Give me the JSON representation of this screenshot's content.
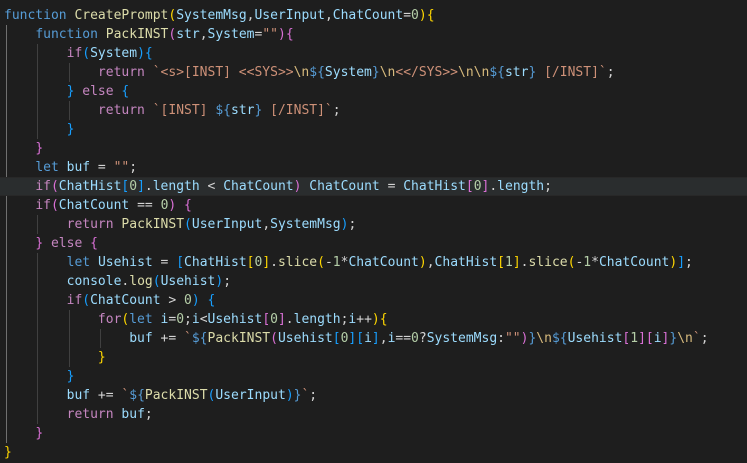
{
  "editor": {
    "language": "javascript",
    "theme": "dark",
    "lines": [
      [
        [
          "kw",
          "function"
        ],
        [
          "op",
          " "
        ],
        [
          "fn",
          "CreatePrompt"
        ],
        [
          "b1",
          "("
        ],
        [
          "var",
          "SystemMsg"
        ],
        [
          "op",
          ","
        ],
        [
          "var",
          "UserInput"
        ],
        [
          "op",
          ","
        ],
        [
          "var",
          "ChatCount"
        ],
        [
          "op",
          "="
        ],
        [
          "num",
          "0"
        ],
        [
          "b1",
          ")"
        ],
        [
          "b1",
          "{"
        ]
      ],
      [
        [
          "op",
          "    "
        ],
        [
          "kw",
          "function"
        ],
        [
          "op",
          " "
        ],
        [
          "fn",
          "PackINST"
        ],
        [
          "b2",
          "("
        ],
        [
          "var",
          "str"
        ],
        [
          "op",
          ","
        ],
        [
          "var",
          "System"
        ],
        [
          "op",
          "="
        ],
        [
          "str",
          "\"\""
        ],
        [
          "b2",
          ")"
        ],
        [
          "b2",
          "{"
        ]
      ],
      [
        [
          "op",
          "        "
        ],
        [
          "ctl",
          "if"
        ],
        [
          "b3",
          "("
        ],
        [
          "var",
          "System"
        ],
        [
          "b3",
          ")"
        ],
        [
          "b3",
          "{"
        ]
      ],
      [
        [
          "op",
          "            "
        ],
        [
          "ctl",
          "return"
        ],
        [
          "op",
          " "
        ],
        [
          "str",
          "`<s>[INST] <<SYS>>"
        ],
        [
          "esc",
          "\\n"
        ],
        [
          "kw",
          "${"
        ],
        [
          "var",
          "System"
        ],
        [
          "kw",
          "}"
        ],
        [
          "esc",
          "\\n"
        ],
        [
          "str",
          "<</SYS>>"
        ],
        [
          "esc",
          "\\n\\n"
        ],
        [
          "kw",
          "${"
        ],
        [
          "var",
          "str"
        ],
        [
          "kw",
          "}"
        ],
        [
          "str",
          " [/INST]`"
        ],
        [
          "op",
          ";"
        ]
      ],
      [
        [
          "op",
          "        "
        ],
        [
          "b3",
          "}"
        ],
        [
          "op",
          " "
        ],
        [
          "ctl",
          "else"
        ],
        [
          "op",
          " "
        ],
        [
          "b3",
          "{"
        ]
      ],
      [
        [
          "op",
          "            "
        ],
        [
          "ctl",
          "return"
        ],
        [
          "op",
          " "
        ],
        [
          "str",
          "`[INST] "
        ],
        [
          "kw",
          "${"
        ],
        [
          "var",
          "str"
        ],
        [
          "kw",
          "}"
        ],
        [
          "str",
          " [/INST]`"
        ],
        [
          "op",
          ";"
        ]
      ],
      [
        [
          "op",
          "        "
        ],
        [
          "b3",
          "}"
        ]
      ],
      [
        [
          "op",
          "    "
        ],
        [
          "b2",
          "}"
        ]
      ],
      [
        [
          "op",
          "    "
        ],
        [
          "kw",
          "let"
        ],
        [
          "op",
          " "
        ],
        [
          "var",
          "buf"
        ],
        [
          "op",
          " = "
        ],
        [
          "str",
          "\"\""
        ],
        [
          "op",
          ";"
        ]
      ],
      [
        [
          "op",
          "    "
        ],
        [
          "ctl",
          "if"
        ],
        [
          "b2",
          "("
        ],
        [
          "var",
          "ChatHist"
        ],
        [
          "b3",
          "["
        ],
        [
          "num",
          "0"
        ],
        [
          "b3",
          "]"
        ],
        [
          "op",
          "."
        ],
        [
          "var",
          "length"
        ],
        [
          "op",
          " < "
        ],
        [
          "var",
          "ChatCount"
        ],
        [
          "b2",
          ")"
        ],
        [
          "op",
          " "
        ],
        [
          "var",
          "ChatCount"
        ],
        [
          "op",
          " = "
        ],
        [
          "var",
          "ChatHist"
        ],
        [
          "b2",
          "["
        ],
        [
          "num",
          "0"
        ],
        [
          "b2",
          "]"
        ],
        [
          "op",
          "."
        ],
        [
          "var",
          "length"
        ],
        [
          "op",
          ";"
        ]
      ],
      [
        [
          "op",
          "    "
        ],
        [
          "ctl",
          "if"
        ],
        [
          "b2",
          "("
        ],
        [
          "var",
          "ChatCount"
        ],
        [
          "op",
          " == "
        ],
        [
          "num",
          "0"
        ],
        [
          "b2",
          ")"
        ],
        [
          "op",
          " "
        ],
        [
          "b2",
          "{"
        ]
      ],
      [
        [
          "op",
          "        "
        ],
        [
          "ctl",
          "return"
        ],
        [
          "op",
          " "
        ],
        [
          "fn",
          "PackINST"
        ],
        [
          "b3",
          "("
        ],
        [
          "var",
          "UserInput"
        ],
        [
          "op",
          ","
        ],
        [
          "var",
          "SystemMsg"
        ],
        [
          "b3",
          ")"
        ],
        [
          "op",
          ";"
        ]
      ],
      [
        [
          "op",
          "    "
        ],
        [
          "b2",
          "}"
        ],
        [
          "op",
          " "
        ],
        [
          "ctl",
          "else"
        ],
        [
          "op",
          " "
        ],
        [
          "b2",
          "{"
        ]
      ],
      [
        [
          "op",
          "        "
        ],
        [
          "kw",
          "let"
        ],
        [
          "op",
          " "
        ],
        [
          "var",
          "Usehist"
        ],
        [
          "op",
          " = "
        ],
        [
          "b3",
          "["
        ],
        [
          "var",
          "ChatHist"
        ],
        [
          "b1",
          "["
        ],
        [
          "num",
          "0"
        ],
        [
          "b1",
          "]"
        ],
        [
          "op",
          "."
        ],
        [
          "fn",
          "slice"
        ],
        [
          "b1",
          "("
        ],
        [
          "op",
          "-"
        ],
        [
          "num",
          "1"
        ],
        [
          "op",
          "*"
        ],
        [
          "var",
          "ChatCount"
        ],
        [
          "b1",
          ")"
        ],
        [
          "op",
          ","
        ],
        [
          "var",
          "ChatHist"
        ],
        [
          "b1",
          "["
        ],
        [
          "num",
          "1"
        ],
        [
          "b1",
          "]"
        ],
        [
          "op",
          "."
        ],
        [
          "fn",
          "slice"
        ],
        [
          "b1",
          "("
        ],
        [
          "op",
          "-"
        ],
        [
          "num",
          "1"
        ],
        [
          "op",
          "*"
        ],
        [
          "var",
          "ChatCount"
        ],
        [
          "b1",
          ")"
        ],
        [
          "b3",
          "]"
        ],
        [
          "op",
          ";"
        ]
      ],
      [
        [
          "op",
          "        "
        ],
        [
          "var",
          "console"
        ],
        [
          "op",
          "."
        ],
        [
          "fn",
          "log"
        ],
        [
          "b3",
          "("
        ],
        [
          "var",
          "Usehist"
        ],
        [
          "b3",
          ")"
        ],
        [
          "op",
          ";"
        ]
      ],
      [
        [
          "op",
          "        "
        ],
        [
          "ctl",
          "if"
        ],
        [
          "b3",
          "("
        ],
        [
          "var",
          "ChatCount"
        ],
        [
          "op",
          " > "
        ],
        [
          "num",
          "0"
        ],
        [
          "b3",
          ")"
        ],
        [
          "op",
          " "
        ],
        [
          "b3",
          "{"
        ]
      ],
      [
        [
          "op",
          "            "
        ],
        [
          "ctl",
          "for"
        ],
        [
          "b1",
          "("
        ],
        [
          "kw",
          "let"
        ],
        [
          "op",
          " "
        ],
        [
          "var",
          "i"
        ],
        [
          "op",
          "="
        ],
        [
          "num",
          "0"
        ],
        [
          "op",
          ";"
        ],
        [
          "var",
          "i"
        ],
        [
          "op",
          "<"
        ],
        [
          "var",
          "Usehist"
        ],
        [
          "b2",
          "["
        ],
        [
          "num",
          "0"
        ],
        [
          "b2",
          "]"
        ],
        [
          "op",
          "."
        ],
        [
          "var",
          "length"
        ],
        [
          "op",
          ";"
        ],
        [
          "var",
          "i"
        ],
        [
          "op",
          "++"
        ],
        [
          "b1",
          ")"
        ],
        [
          "b1",
          "{"
        ]
      ],
      [
        [
          "op",
          "                "
        ],
        [
          "var",
          "buf"
        ],
        [
          "op",
          " += "
        ],
        [
          "str",
          "`"
        ],
        [
          "kw",
          "${"
        ],
        [
          "fn",
          "PackINST"
        ],
        [
          "b2",
          "("
        ],
        [
          "var",
          "Usehist"
        ],
        [
          "b3",
          "["
        ],
        [
          "num",
          "0"
        ],
        [
          "b3",
          "]"
        ],
        [
          "b3",
          "["
        ],
        [
          "var",
          "i"
        ],
        [
          "b3",
          "]"
        ],
        [
          "op",
          ","
        ],
        [
          "var",
          "i"
        ],
        [
          "op",
          "=="
        ],
        [
          "num",
          "0"
        ],
        [
          "op",
          "?"
        ],
        [
          "var",
          "SystemMsg"
        ],
        [
          "op",
          ":"
        ],
        [
          "str",
          "\"\""
        ],
        [
          "b2",
          ")"
        ],
        [
          "kw",
          "}"
        ],
        [
          "esc",
          "\\n"
        ],
        [
          "kw",
          "${"
        ],
        [
          "var",
          "Usehist"
        ],
        [
          "b2",
          "["
        ],
        [
          "num",
          "1"
        ],
        [
          "b2",
          "]"
        ],
        [
          "b2",
          "["
        ],
        [
          "var",
          "i"
        ],
        [
          "b2",
          "]"
        ],
        [
          "kw",
          "}"
        ],
        [
          "esc",
          "\\n"
        ],
        [
          "str",
          "`"
        ],
        [
          "op",
          ";"
        ]
      ],
      [
        [
          "op",
          "            "
        ],
        [
          "b1",
          "}"
        ]
      ],
      [
        [
          "op",
          "        "
        ],
        [
          "b3",
          "}"
        ]
      ],
      [
        [
          "op",
          "        "
        ],
        [
          "var",
          "buf"
        ],
        [
          "op",
          " += "
        ],
        [
          "str",
          "`"
        ],
        [
          "kw",
          "${"
        ],
        [
          "fn",
          "PackINST"
        ],
        [
          "b3",
          "("
        ],
        [
          "var",
          "UserInput"
        ],
        [
          "b3",
          ")"
        ],
        [
          "kw",
          "}"
        ],
        [
          "str",
          "`"
        ],
        [
          "op",
          ";"
        ]
      ],
      [
        [
          "op",
          "        "
        ],
        [
          "ctl",
          "return"
        ],
        [
          "op",
          " "
        ],
        [
          "var",
          "buf"
        ],
        [
          "op",
          ";"
        ]
      ],
      [
        [
          "op",
          "    "
        ],
        [
          "b2",
          "}"
        ]
      ],
      [
        [
          "b1",
          "}"
        ]
      ]
    ],
    "current_line": 9
  }
}
